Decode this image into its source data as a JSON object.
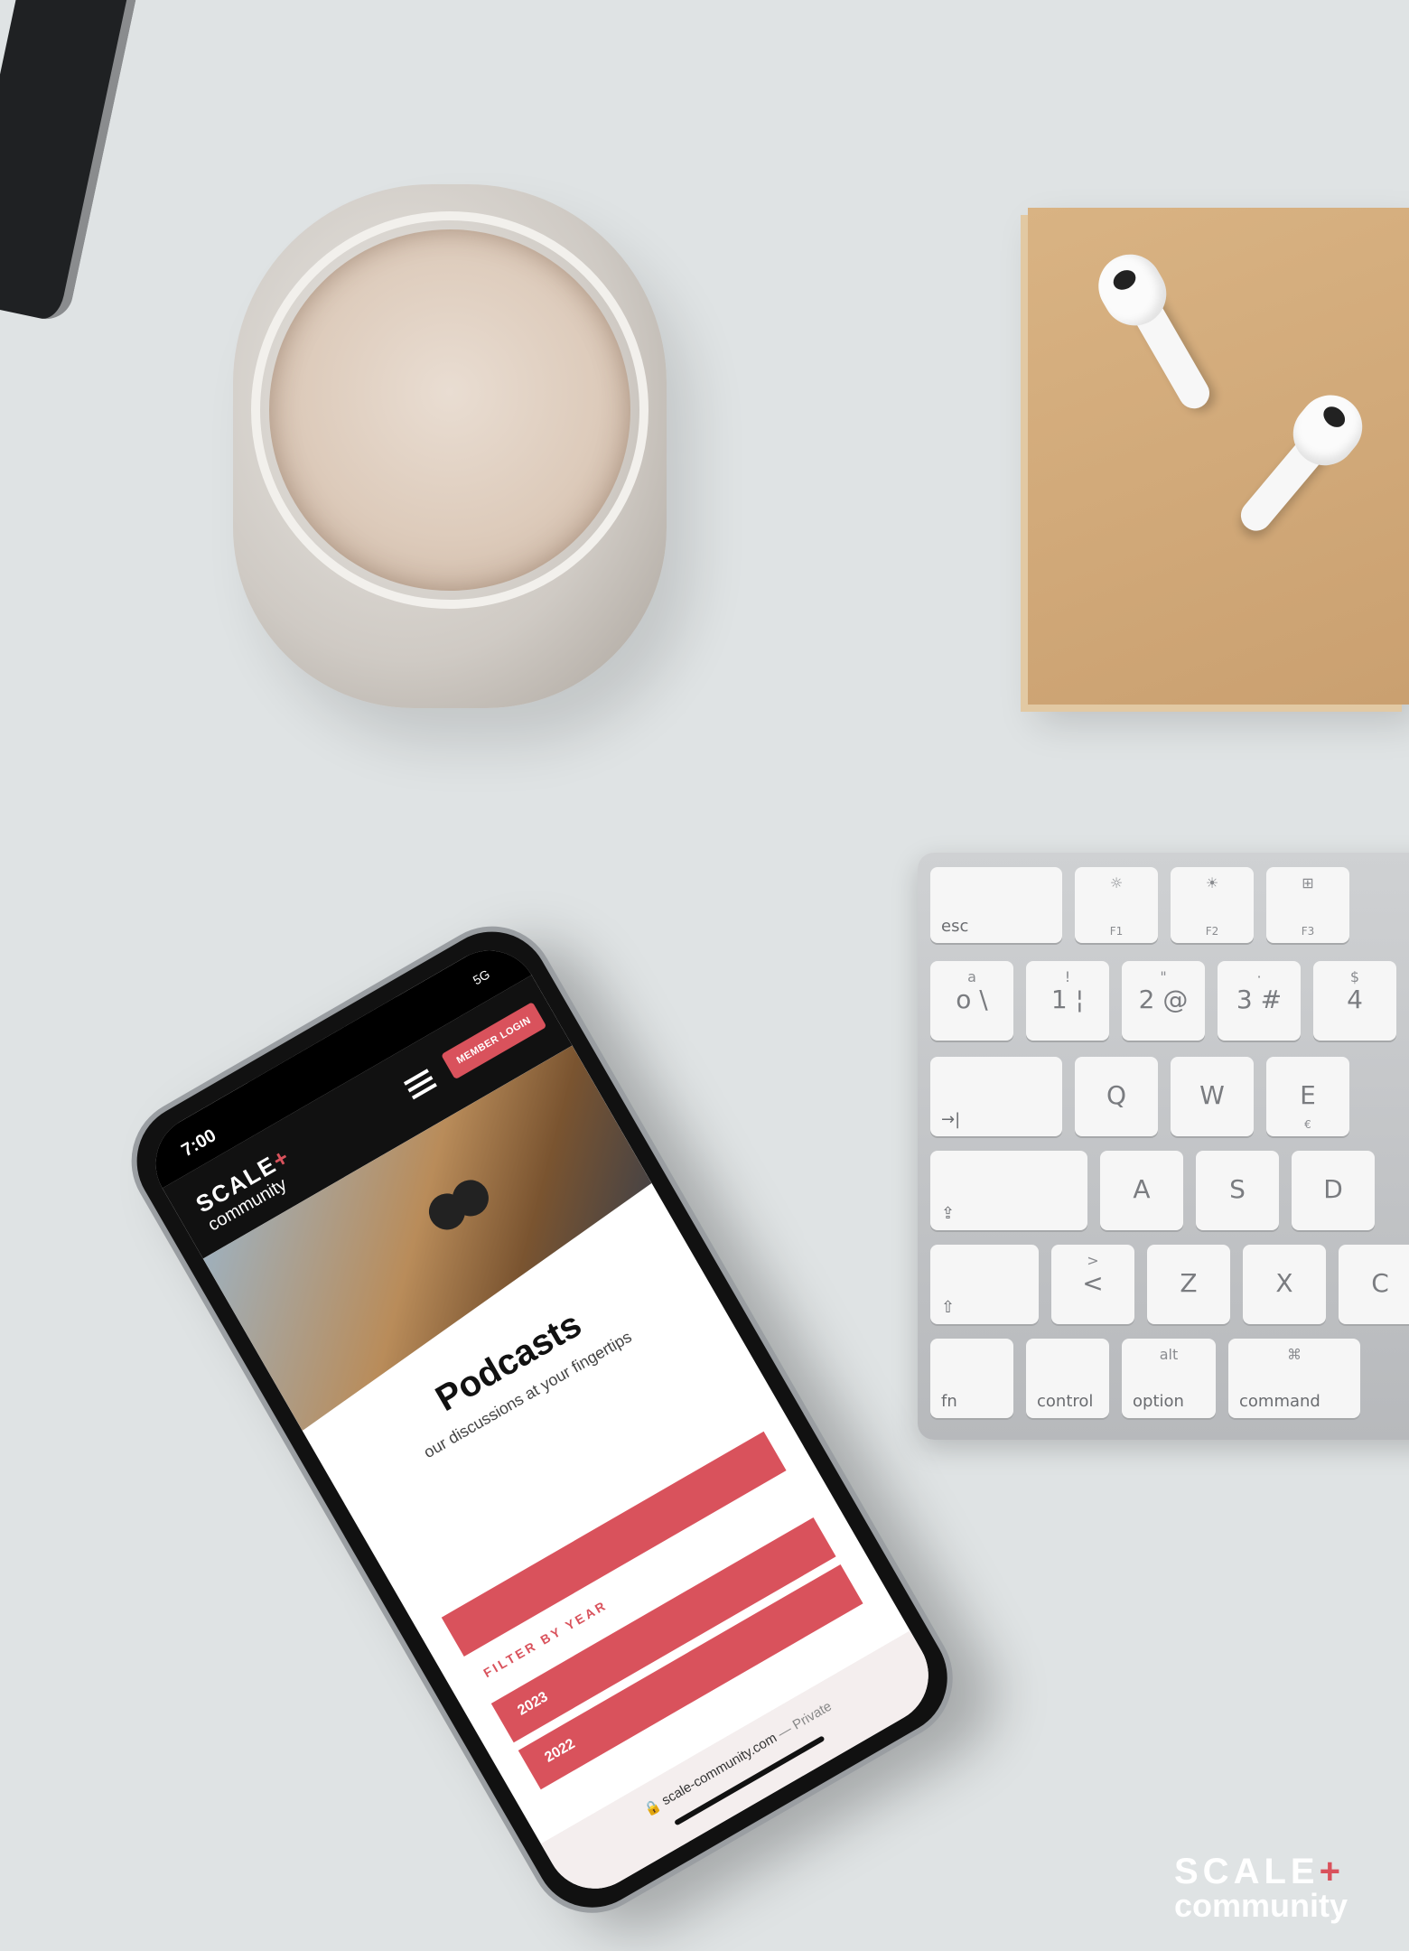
{
  "phone": {
    "status_time": "7:00",
    "status_network": "5G",
    "logo_word": "SCALE",
    "logo_plus": "+",
    "logo_sub": "community",
    "member_login_label": "MEMBER LOGIN",
    "page_title": "Podcasts",
    "page_subtitle": "our discussions at your fingertips",
    "filter_label": "FILTER BY YEAR",
    "years": [
      "2023",
      "2022"
    ],
    "url_text": "scale-community.com",
    "url_suffix": "— Private",
    "accent_color": "#d9525c"
  },
  "keyboard": {
    "row1": [
      {
        "label": "esc"
      },
      {
        "top": "☼",
        "sub": "F1"
      },
      {
        "top": "☀",
        "sub": "F2"
      },
      {
        "top": "⊞",
        "sub": "F3"
      }
    ],
    "row2": [
      {
        "top": "a",
        "big": "o \\"
      },
      {
        "top": "!",
        "big": "1 ¦"
      },
      {
        "top": "\"",
        "big": "2 @"
      },
      {
        "top": "·",
        "big": "3 #"
      },
      {
        "top": "$",
        "big": "4"
      }
    ],
    "row3": [
      {
        "label": "→|"
      },
      {
        "big": "Q"
      },
      {
        "big": "W"
      },
      {
        "big": "E",
        "sub": "€"
      }
    ],
    "row4": [
      {
        "label": "⇪"
      },
      {
        "big": "A"
      },
      {
        "big": "S"
      },
      {
        "big": "D"
      }
    ],
    "row5": [
      {
        "label": "⇧"
      },
      {
        "top": ">",
        "big": "<"
      },
      {
        "big": "Z"
      },
      {
        "big": "X"
      },
      {
        "big": "C"
      }
    ],
    "row6": [
      {
        "label": "fn"
      },
      {
        "label": "control"
      },
      {
        "top": "alt",
        "label": "option"
      },
      {
        "top": "⌘",
        "label": "command"
      }
    ]
  },
  "watermark": {
    "word": "SCALE",
    "plus": "+",
    "sub": "community"
  }
}
